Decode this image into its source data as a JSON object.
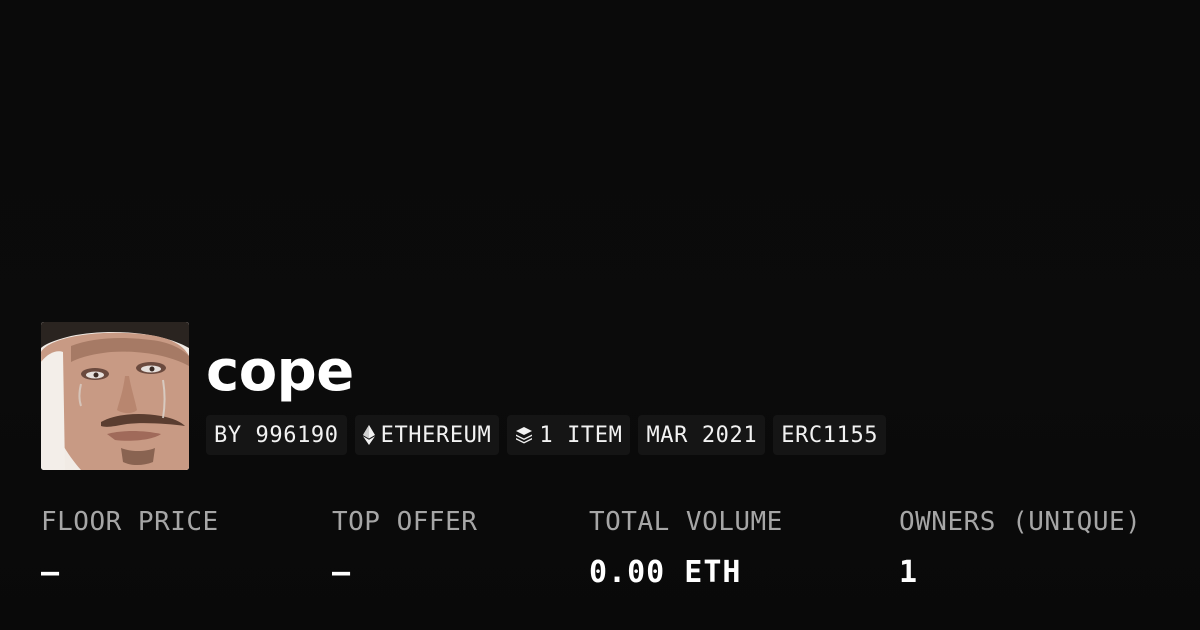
{
  "collection": {
    "name": "cope",
    "avatar_icon": "crying-man-portrait"
  },
  "tags": {
    "creator": "BY 996190",
    "chain": "ETHEREUM",
    "chain_icon": "ethereum-icon",
    "items": "1 ITEM",
    "items_icon": "layers-icon",
    "created": "MAR 2021",
    "standard": "ERC1155"
  },
  "stats": {
    "floor_price": {
      "label": "FLOOR PRICE",
      "value": "–"
    },
    "top_offer": {
      "label": "TOP OFFER",
      "value": "–"
    },
    "total_volume": {
      "label": "TOTAL VOLUME",
      "value": "0.00 ETH"
    },
    "owners": {
      "label": "OWNERS (UNIQUE)",
      "value": "1"
    }
  },
  "colors": {
    "background": "#0b0b0b",
    "tag_background": "#151515",
    "label_gray": "#a6a6a6",
    "text_white": "#ffffff"
  }
}
